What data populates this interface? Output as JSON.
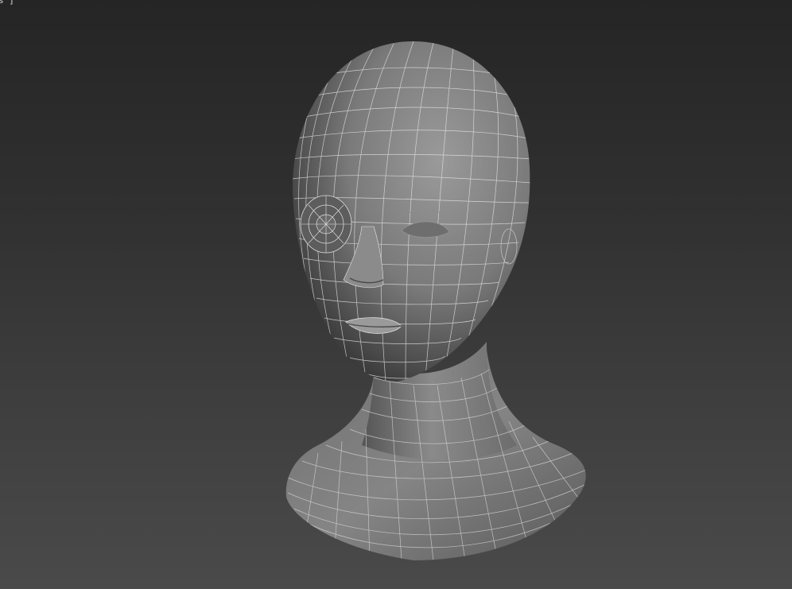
{
  "viewport": {
    "label": "s ]",
    "model": "head-bust-wireframe-shaded"
  },
  "colors": {
    "background_top": "#252525",
    "background_bottom": "#4a4a4a",
    "model_base": "#7c7c7c",
    "wire": "#e6e6e6"
  }
}
